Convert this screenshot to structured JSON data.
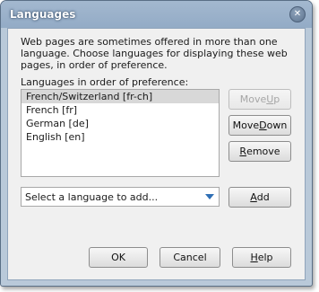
{
  "window": {
    "title": "Languages"
  },
  "description": "Web pages are sometimes offered in more than one language. Choose languages for displaying these web pages, in order of preference.",
  "list": {
    "label": "Languages in order of preference:",
    "items": [
      {
        "label": "French/Switzerland  [fr-ch]",
        "selected": true
      },
      {
        "label": "French  [fr]",
        "selected": false
      },
      {
        "label": "German  [de]",
        "selected": false
      },
      {
        "label": "English  [en]",
        "selected": false
      }
    ]
  },
  "buttons": {
    "move_up": {
      "pre": "Move ",
      "key": "U",
      "post": "p",
      "enabled": false
    },
    "move_down": {
      "pre": "Move ",
      "key": "D",
      "post": "own",
      "enabled": true
    },
    "remove": {
      "pre": "",
      "key": "R",
      "post": "emove",
      "enabled": true
    },
    "add": {
      "pre": "",
      "key": "A",
      "post": "dd",
      "enabled": true
    },
    "ok": {
      "label": "OK"
    },
    "cancel": {
      "label": "Cancel"
    },
    "help": {
      "pre": "",
      "key": "H",
      "post": "elp"
    }
  },
  "add_select": {
    "placeholder": "Select a language to add...",
    "arrow_color": "#2f6fb5"
  },
  "icons": {
    "close": "close-icon",
    "dropdown": "chevron-down-icon"
  }
}
